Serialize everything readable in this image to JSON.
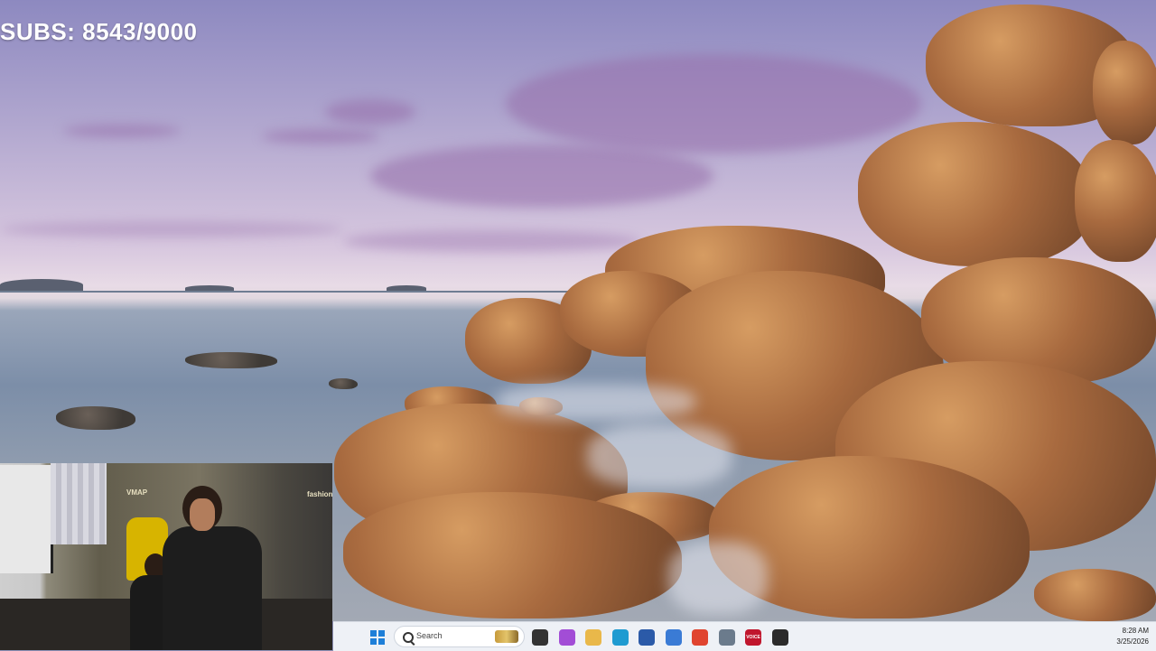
{
  "overlay": {
    "subs_counter": "SUBS: 8543/9000"
  },
  "taskbar": {
    "search_placeholder": "Search",
    "apps": [
      {
        "name": "task-view-icon",
        "color": "#333333",
        "label": ""
      },
      {
        "name": "copilot-icon",
        "color": "#a24dd6",
        "label": ""
      },
      {
        "name": "file-explorer-icon",
        "color": "#e9b84a",
        "label": ""
      },
      {
        "name": "edge-icon",
        "color": "#1f9bd1",
        "label": ""
      },
      {
        "name": "store-icon",
        "color": "#2b5aa8",
        "label": ""
      },
      {
        "name": "teams-icon",
        "color": "#3a7bd5",
        "label": ""
      },
      {
        "name": "chrome-icon",
        "color": "#e0442f",
        "label": ""
      },
      {
        "name": "settings-icon",
        "color": "#6b7b8c",
        "label": ""
      },
      {
        "name": "voicemod-icon",
        "color": "#c0162d",
        "label": "VOICE"
      },
      {
        "name": "obs-icon",
        "color": "#2b2b2b",
        "label": ""
      }
    ],
    "clock": {
      "time": "8:28 AM",
      "date": "3/25/2026"
    }
  },
  "webcam": {
    "logos": [
      "VMAP",
      "fashionmy"
    ]
  },
  "colors": {
    "taskbar_bg": "#eef1f6",
    "start_blue": "#1e7fd8"
  }
}
